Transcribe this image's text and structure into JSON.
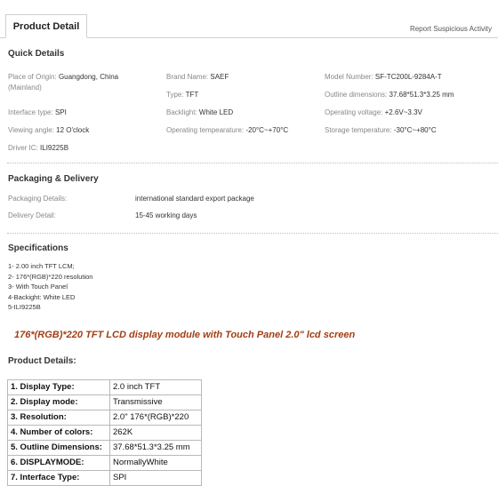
{
  "tabs": {
    "active": "Product Detail",
    "report": "Report Suspicious Activity"
  },
  "quick": {
    "title": "Quick Details",
    "items": [
      {
        "label": "Place of Origin:",
        "value": "Guangdong, China"
      },
      {
        "label": "(Mainland)",
        "value": ""
      },
      {
        "label": "Brand Name:",
        "value": "SAEF"
      },
      {
        "label": "Model Number:",
        "value": "SF-TC200L-9284A-T"
      },
      {
        "label": "Type:",
        "value": "TFT"
      },
      {
        "label": "Outline dimensions:",
        "value": "37.68*51.3*3.25 mm"
      },
      {
        "label": "Interface type:",
        "value": "SPI"
      },
      {
        "label": "Backlight:",
        "value": "White LED"
      },
      {
        "label": "Operating voltage:",
        "value": "+2.6V~3.3V"
      },
      {
        "label": "Viewing angle:",
        "value": "12 O'clock"
      },
      {
        "label": "Operating tempearature:",
        "value": "-20°C~+70°C"
      },
      {
        "label": "Storage temperature:",
        "value": "-30°C~+80°C"
      },
      {
        "label": "Driver IC:",
        "value": "ILI9225B"
      }
    ]
  },
  "packaging": {
    "title": "Packaging & Delivery",
    "rows": [
      {
        "label": "Packaging Details:",
        "value": "international standard export package"
      },
      {
        "label": "Delivery Detail:",
        "value": "15-45 working days"
      }
    ]
  },
  "specs": {
    "title": "Specifications",
    "lines": [
      "1- 2.00 inch TFT LCM;",
      "2- 176*(RGB)*220 resolution",
      "3- With Touch Panel",
      "4-Backight: White LED",
      "5-ILI9225B"
    ]
  },
  "headline": "176*(RGB)*220 TFT LCD display module with Touch Panel 2.0\" lcd screen",
  "details": {
    "title": "Product Details:",
    "rows": [
      {
        "k": "1. Display Type:",
        "v": "2.0 inch TFT"
      },
      {
        "k": "2. Display mode:",
        "v": "Transmissive"
      },
      {
        "k": "3. Resolution:",
        "v": "2.0\" 176*(RGB)*220"
      },
      {
        "k": "4. Number of colors:",
        "v": "262K"
      },
      {
        "k": "5. Outline Dimensions:",
        "v": "37.68*51.3*3.25 mm"
      },
      {
        "k": "6. DISPLAYMODE:",
        "v": "NormallyWhite"
      },
      {
        "k": "7. Interface Type:",
        "v": "SPI"
      }
    ]
  }
}
